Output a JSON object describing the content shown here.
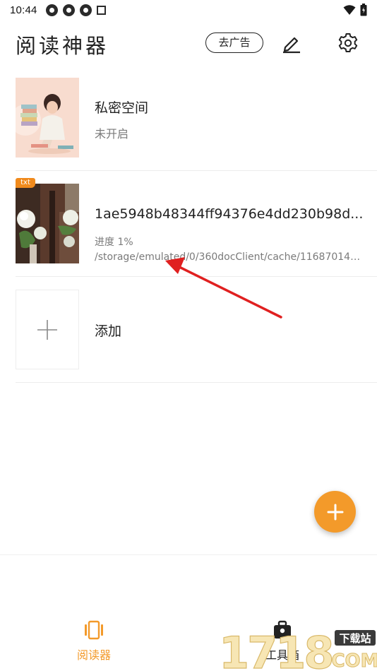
{
  "status_bar": {
    "time": "10:44"
  },
  "header": {
    "title": "阅读神器",
    "ad_button_label": "去广告"
  },
  "list": {
    "private_space": {
      "title": "私密空间",
      "status": "未开启"
    },
    "book": {
      "badge": "txt",
      "title": "1ae5948b48344ff94376e4dd230b98d...",
      "progress": "进度  1%",
      "path": "/storage/emulated/0/360docClient/cache/1168701428..."
    },
    "add": {
      "label": "添加"
    }
  },
  "bottom_nav": {
    "reader_label": "阅读器",
    "tools_label": "工具箱"
  },
  "watermark": {
    "digits": "1718",
    "text_top": "下载站",
    "text_bottom": "COM"
  },
  "colors": {
    "accent": "#f39a2a",
    "arrow": "#e02020"
  }
}
